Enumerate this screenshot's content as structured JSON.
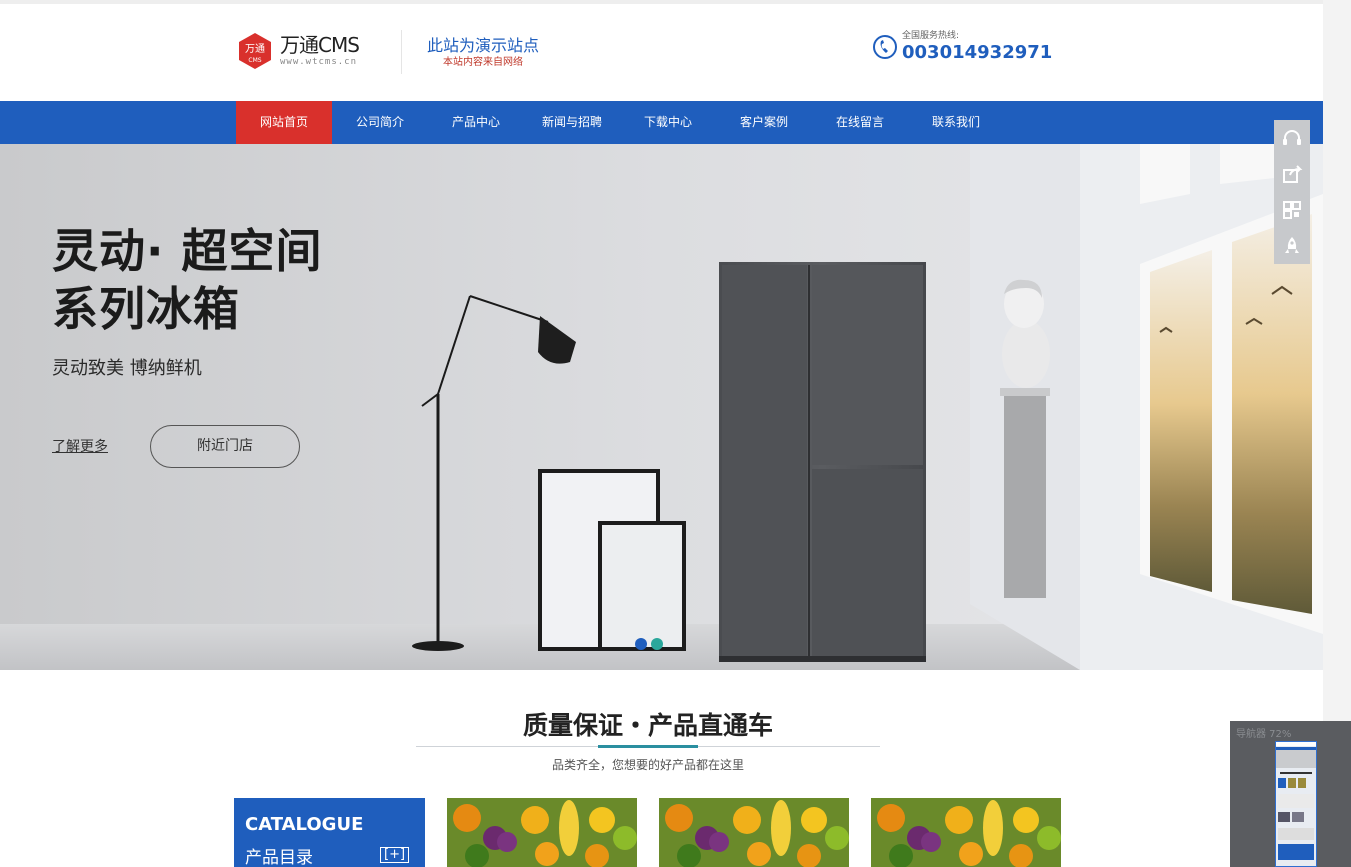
{
  "header": {
    "logo_badge": "万通",
    "logo_badge_sub": "CMS",
    "logo_name": "万通CMS",
    "logo_url": "www.wtcms.cn",
    "demo_line1": "此站为演示站点",
    "demo_line2": "本站内容来自网络",
    "hotline_label": "全国服务热线:",
    "hotline_number": "003014932971"
  },
  "nav": {
    "items": [
      {
        "label": "网站首页",
        "active": true
      },
      {
        "label": "公司简介"
      },
      {
        "label": "产品中心"
      },
      {
        "label": "新闻与招聘"
      },
      {
        "label": "下载中心"
      },
      {
        "label": "客户案例"
      },
      {
        "label": "在线留言"
      },
      {
        "label": "联系我们"
      }
    ]
  },
  "hero": {
    "title_line1": "灵动· 超空间",
    "title_line2": "系列冰箱",
    "subtitle": "灵动致美 博纳鲜机",
    "more_label": "了解更多",
    "store_label": "附近门店",
    "slides_total": 2,
    "slide_active": 1,
    "dot_colors": [
      "#1f5ebd",
      "#2aa79b"
    ]
  },
  "side_tools": {
    "icons": [
      "headset-icon",
      "share-icon",
      "qrcode-icon",
      "rocket-icon"
    ]
  },
  "section": {
    "title": "质量保证・产品直通车",
    "subtitle": "品类齐全，您想要的好产品都在这里"
  },
  "catalogue": {
    "en": "CATALOGUE",
    "cn": "产品目录",
    "plus": "[+]"
  },
  "minimap": {
    "label": "导航器 72%"
  },
  "colors": {
    "brand_blue": "#1f5ebd",
    "active_red": "#d9302c"
  }
}
